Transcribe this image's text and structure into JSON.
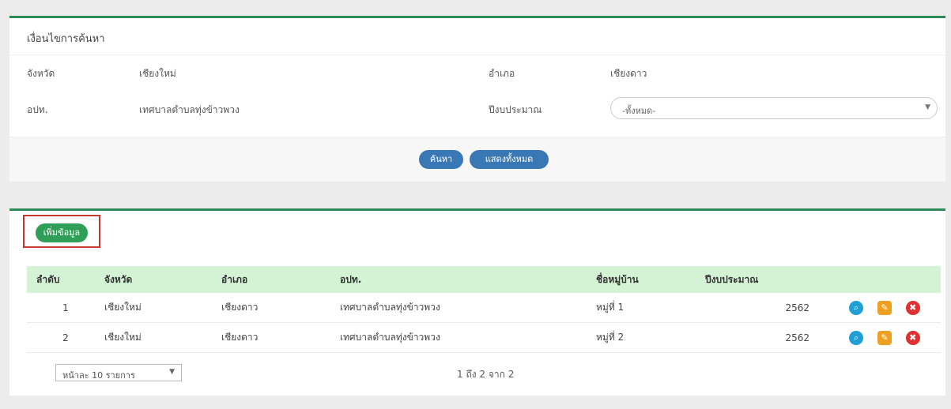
{
  "search_panel": {
    "title": "เงื่อนไขการค้นหา",
    "province_label": "จังหวัด",
    "province_value": "เชียงใหม่",
    "district_label": "อำเภอ",
    "district_value": "เชียงดาว",
    "org_label": "อปท.",
    "org_value": "เทศบาลตำบลทุ่งข้าวพวง",
    "year_label": "ปีงบประมาณ",
    "year_select_value": "-ทั้งหมด-",
    "search_button": "ค้นหา",
    "show_all_button": "แสดงทั้งหมด"
  },
  "list_panel": {
    "add_button": "เพิ่มข้อมูล",
    "columns": [
      "ลำดับ",
      "จังหวัด",
      "อำเภอ",
      "อปท.",
      "ชื่อหมู่บ้าน",
      "ปีงบประมาณ",
      ""
    ],
    "rows": [
      {
        "no": "1",
        "province": "เชียงใหม่",
        "district": "เชียงดาว",
        "org": "เทศบาลตำบลทุ่งข้าวพวง",
        "village": "หมู่ที่ 1",
        "year": "2562"
      },
      {
        "no": "2",
        "province": "เชียงใหม่",
        "district": "เชียงดาว",
        "org": "เทศบาลตำบลทุ่งข้าวพวง",
        "village": "หมู่ที่ 2",
        "year": "2562"
      }
    ],
    "per_page": "หน้าละ 10 รายการ",
    "info": "1 ถึง 2 จาก 2"
  },
  "icons": {
    "view": "search-icon",
    "edit": "edit-icon",
    "delete": "trash-icon"
  },
  "colors": {
    "accent_green": "#2e8b57",
    "header_bg": "#d4f2d4",
    "button_blue": "#3a78b5",
    "button_green": "#2f9e56"
  }
}
